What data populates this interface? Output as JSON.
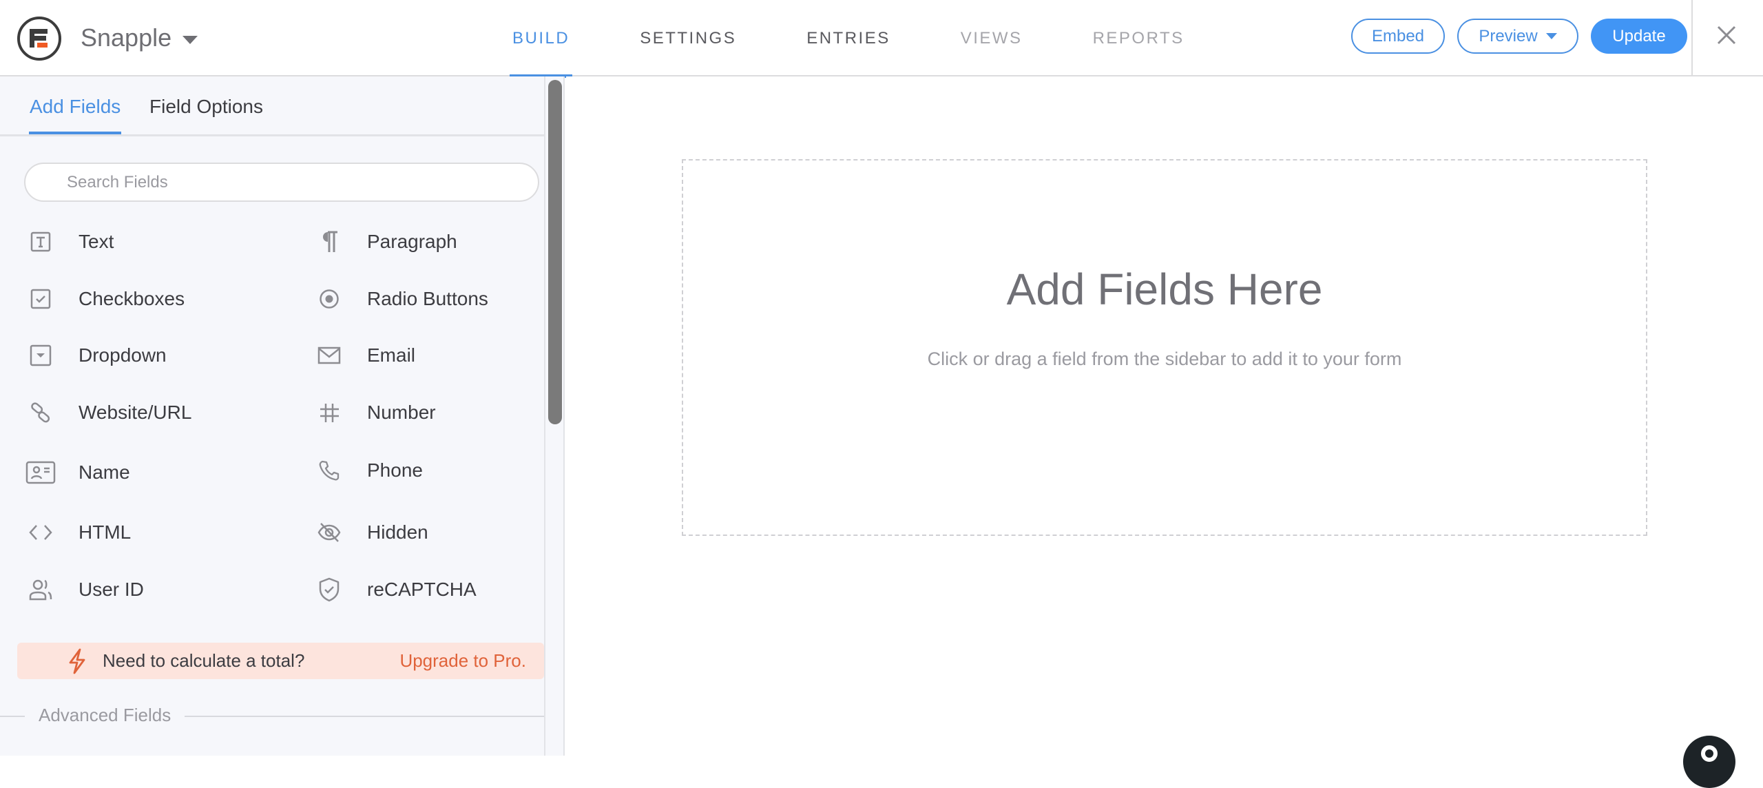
{
  "header": {
    "form_name": "Snapple",
    "nav_tabs": [
      {
        "label": "BUILD",
        "state": "active"
      },
      {
        "label": "SETTINGS",
        "state": "normal"
      },
      {
        "label": "ENTRIES",
        "state": "normal"
      },
      {
        "label": "VIEWS",
        "state": "disabled"
      },
      {
        "label": "REPORTS",
        "state": "disabled"
      }
    ],
    "embed_label": "Embed",
    "preview_label": "Preview",
    "update_label": "Update",
    "close_icon": "close-icon"
  },
  "sidebar": {
    "tabs": [
      {
        "label": "Add Fields",
        "active": true
      },
      {
        "label": "Field Options",
        "active": false
      }
    ],
    "search_placeholder": "Search Fields",
    "search_value": "",
    "fields": [
      {
        "label": "Text",
        "icon": "text-field-icon"
      },
      {
        "label": "Paragraph",
        "icon": "paragraph-icon"
      },
      {
        "label": "Checkboxes",
        "icon": "checkbox-icon"
      },
      {
        "label": "Radio Buttons",
        "icon": "radio-button-icon"
      },
      {
        "label": "Dropdown",
        "icon": "dropdown-icon"
      },
      {
        "label": "Email",
        "icon": "envelope-icon"
      },
      {
        "label": "Website/URL",
        "icon": "link-icon"
      },
      {
        "label": "Number",
        "icon": "hash-icon"
      },
      {
        "label": "Name",
        "icon": "id-card-icon"
      },
      {
        "label": "Phone",
        "icon": "phone-icon"
      },
      {
        "label": "HTML",
        "icon": "code-icon"
      },
      {
        "label": "Hidden",
        "icon": "eye-slash-icon"
      },
      {
        "label": "User ID",
        "icon": "users-icon"
      },
      {
        "label": "reCAPTCHA",
        "icon": "shield-check-icon"
      }
    ],
    "promo": {
      "text": "Need to calculate a total?",
      "link": "Upgrade to Pro.",
      "icon": "lightning-bolt-icon"
    },
    "advanced_section_title": "Advanced Fields"
  },
  "canvas": {
    "title": "Add Fields Here",
    "subtitle": "Click or drag a field from the sidebar to add it to your form"
  },
  "colors": {
    "accent": "#4a90e2",
    "primary_button": "#4195f5",
    "promo_bg": "#fde4dd",
    "promo_link": "#e0633a",
    "logo_orange": "#f05a24",
    "logo_dark": "#3c3c3c"
  }
}
